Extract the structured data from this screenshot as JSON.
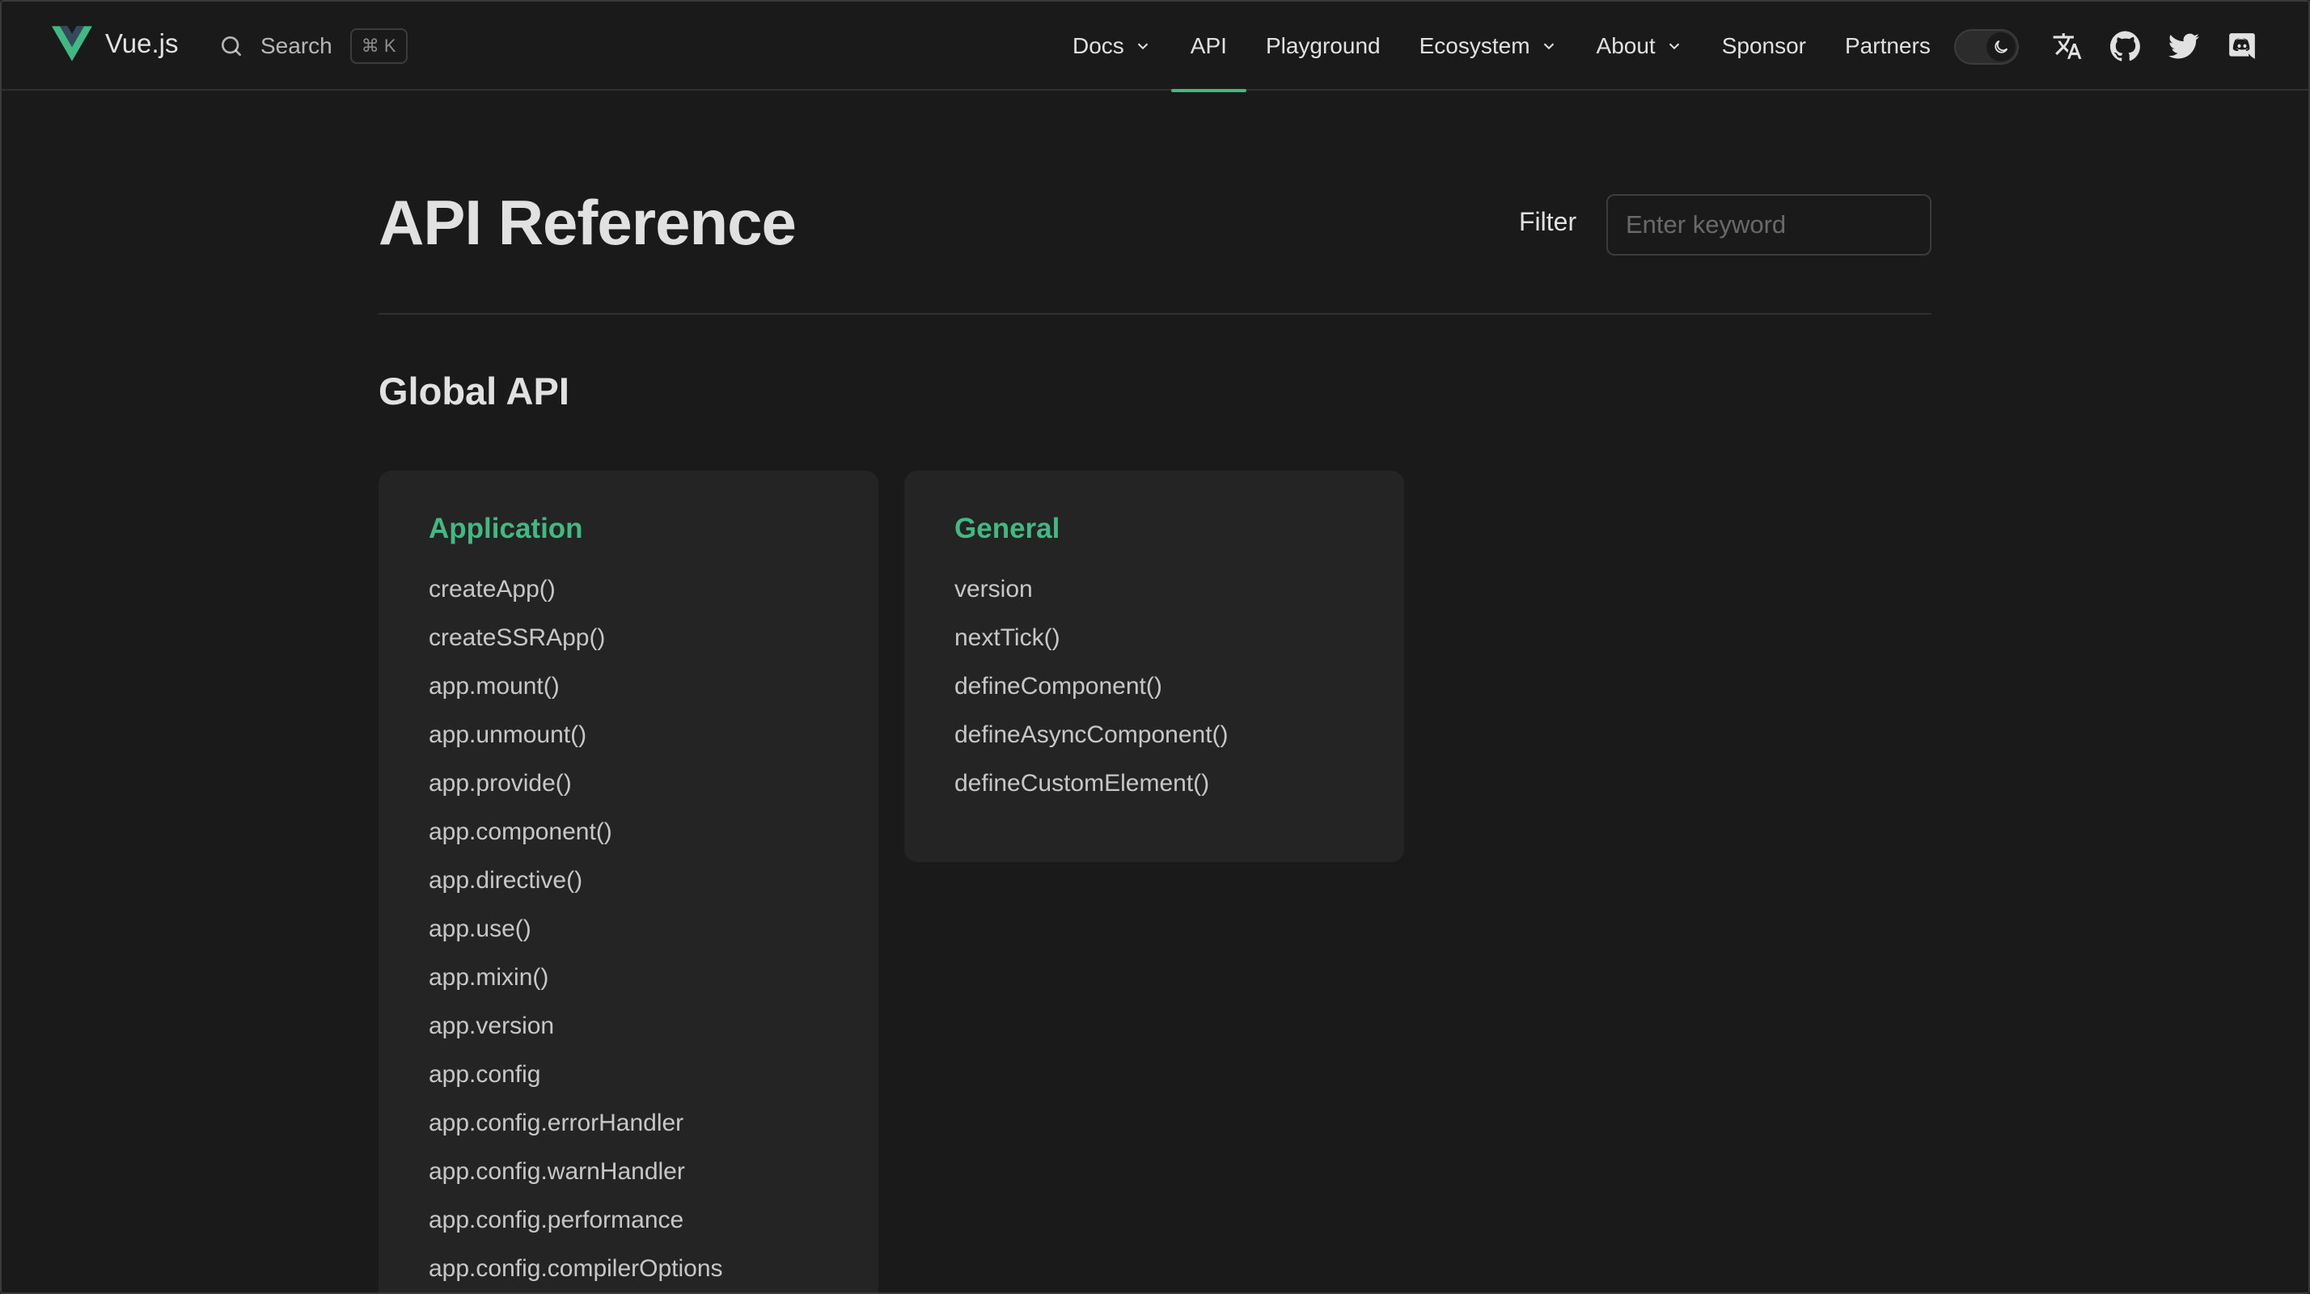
{
  "brand": {
    "name": "Vue.js",
    "logo_icon": "vue-logo-icon",
    "accent": "#42b883"
  },
  "search": {
    "label": "Search",
    "shortcut": "⌘ K",
    "icon": "search-icon"
  },
  "nav": {
    "items": [
      {
        "label": "Docs",
        "has_dropdown": true
      },
      {
        "label": "API",
        "has_dropdown": false,
        "active": true
      },
      {
        "label": "Playground",
        "has_dropdown": false
      },
      {
        "label": "Ecosystem",
        "has_dropdown": true
      },
      {
        "label": "About",
        "has_dropdown": true
      },
      {
        "label": "Sponsor",
        "has_dropdown": false
      },
      {
        "label": "Partners",
        "has_dropdown": false
      }
    ],
    "icons": [
      "theme-toggle-moon-icon",
      "translate-icon",
      "github-icon",
      "twitter-icon",
      "discord-icon"
    ]
  },
  "page": {
    "title": "API Reference",
    "filter": {
      "label": "Filter",
      "placeholder": "Enter keyword",
      "value": ""
    },
    "section_title": "Global API",
    "cards": [
      {
        "title": "Application",
        "items": [
          "createApp()",
          "createSSRApp()",
          "app.mount()",
          "app.unmount()",
          "app.provide()",
          "app.component()",
          "app.directive()",
          "app.use()",
          "app.mixin()",
          "app.version",
          "app.config",
          "app.config.errorHandler",
          "app.config.warnHandler",
          "app.config.performance",
          "app.config.compilerOptions"
        ]
      },
      {
        "title": "General",
        "items": [
          "version",
          "nextTick()",
          "defineComponent()",
          "defineAsyncComponent()",
          "defineCustomElement()"
        ]
      }
    ]
  }
}
